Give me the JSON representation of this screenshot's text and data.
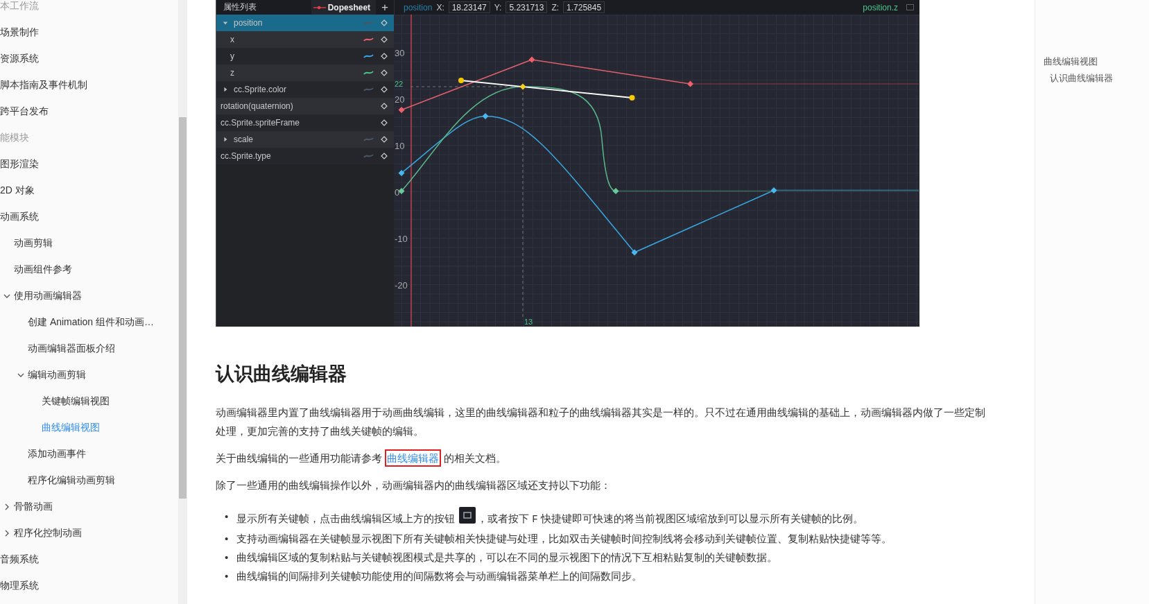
{
  "sidebar": {
    "items": [
      {
        "label": "本工作流",
        "kind": "heading"
      },
      {
        "label": "场景制作",
        "kind": "link",
        "selected": false
      },
      {
        "label": "资源系统",
        "kind": "link",
        "selected": false
      },
      {
        "label": "脚本指南及事件机制",
        "kind": "link",
        "selected": false
      },
      {
        "label": "跨平台发布",
        "kind": "link",
        "selected": false
      },
      {
        "label": "能模块",
        "kind": "heading"
      },
      {
        "label": "图形渲染",
        "kind": "link",
        "selected": false
      },
      {
        "label": "2D 对象",
        "kind": "link",
        "selected": false
      },
      {
        "label": "动画系统",
        "kind": "link",
        "selected": false,
        "children": [
          {
            "label": "动画剪辑",
            "kind": "link",
            "selected": false
          },
          {
            "label": "动画组件参考",
            "kind": "link",
            "selected": false
          },
          {
            "label": "使用动画编辑器",
            "kind": "group",
            "expanded": true,
            "selected": false,
            "children": [
              {
                "label": "创建 Animation 组件和动画…",
                "kind": "link",
                "selected": false
              },
              {
                "label": "动画编辑器面板介绍",
                "kind": "link",
                "selected": false
              },
              {
                "label": "编辑动画剪辑",
                "kind": "group",
                "expanded": true,
                "selected": false,
                "children": [
                  {
                    "label": "关键帧编辑视图",
                    "kind": "link",
                    "selected": false
                  },
                  {
                    "label": "曲线编辑视图",
                    "kind": "link",
                    "selected": true
                  }
                ]
              },
              {
                "label": "添加动画事件",
                "kind": "link",
                "selected": false
              },
              {
                "label": "程序化编辑动画剪辑",
                "kind": "link",
                "selected": false
              }
            ]
          },
          {
            "label": "骨骼动画",
            "kind": "group",
            "expanded": false,
            "selected": false
          },
          {
            "label": "程序化控制动画",
            "kind": "group",
            "expanded": false,
            "selected": false
          }
        ]
      },
      {
        "label": "音频系统",
        "kind": "link",
        "selected": false
      },
      {
        "label": "物理系统",
        "kind": "link",
        "selected": false
      }
    ]
  },
  "editor": {
    "panel_title": "属性列表",
    "dopesheet_button": "Dopesheet",
    "add_button": "+",
    "property_label": "position",
    "fields": [
      {
        "label": "X:",
        "value": "18.23147"
      },
      {
        "label": "Y:",
        "value": "5.231713"
      },
      {
        "label": "Z:",
        "value": "1.725845"
      }
    ],
    "curve_label": "position.z",
    "properties": [
      {
        "label": "position",
        "kind": "group",
        "expanded": true,
        "selected": true,
        "color": "#4a5566"
      },
      {
        "label": "x",
        "kind": "channel",
        "selected": false,
        "color": "#f0606a"
      },
      {
        "label": "y",
        "kind": "channel",
        "selected": false,
        "color": "#3aa8e8"
      },
      {
        "label": "z",
        "kind": "channel",
        "selected": false,
        "color": "#4cc38a"
      },
      {
        "label": "cc.Sprite.color",
        "kind": "group",
        "expanded": false,
        "selected": false,
        "color": "#4a5566"
      },
      {
        "label": "rotation(quaternion)",
        "kind": "plain",
        "selected": false
      },
      {
        "label": "cc.Sprite.spriteFrame",
        "kind": "plain",
        "selected": false
      },
      {
        "label": "scale",
        "kind": "group",
        "expanded": false,
        "selected": false,
        "color": "#4a5566"
      },
      {
        "label": "cc.Sprite.type",
        "kind": "plain",
        "selected": false,
        "color": "#4a5566"
      }
    ],
    "y_labels": [
      "30",
      "20",
      "10",
      "0",
      "-10",
      "-20"
    ],
    "cursor_value": "22",
    "frame_label": "13"
  },
  "article": {
    "heading": "认识曲线编辑器",
    "intro": "动画编辑器里内置了曲线编辑器用于动画曲线编辑，这里的曲线编辑器和粒子的曲线编辑器其实是一样的。只不过在通用曲线编辑的基础上，动画编辑器内做了一些定制处理，更加完善的支持了曲线关键帧的编辑。",
    "reference": {
      "before": "关于曲线编辑的一些通用功能请参考 ",
      "link": "曲线编辑器",
      "after": " 的相关文档。",
      "highlighted": true
    },
    "lead": "除了一些通用的曲线编辑操作以外，动画编辑器内的曲线编辑器区域还支持以下功能：",
    "bullets": [
      {
        "marker": "•",
        "parts": [
          {
            "kind": "text",
            "text": "显示所有关键帧，点击曲线编辑区域上方的按钮 "
          },
          {
            "kind": "icon"
          },
          {
            "kind": "text",
            "text": "，或者按下 "
          },
          {
            "kind": "code",
            "text": "F"
          },
          {
            "kind": "text",
            "text": " 快捷键即可快速的将当前视图区域缩放到可以显示所有关键帧的比例。"
          }
        ]
      },
      {
        "marker": "•",
        "parts": [
          {
            "kind": "text",
            "text": "支持动画编辑器在关键帧显示视图下所有关键帧相关快捷键与处理，比如双击关键帧时间控制线将会移动到关键帧位置、复制粘贴快捷键等等。"
          }
        ]
      },
      {
        "marker": "•",
        "parts": [
          {
            "kind": "text",
            "text": "曲线编辑区域的复制粘贴与关键帧视图模式是共享的，可以在不同的显示视图下的情况下互相粘贴复制的关键帧数据。"
          }
        ]
      },
      {
        "marker": "•",
        "parts": [
          {
            "kind": "text",
            "text": "曲线编辑的间隔排列关键帧功能使用的间隔数将会与动画编辑器菜单栏上的间隔数同步。"
          }
        ]
      }
    ]
  },
  "toc": {
    "items": [
      {
        "label": "曲线编辑视图",
        "children": [
          {
            "label": "认识曲线编辑器"
          }
        ]
      }
    ]
  }
}
